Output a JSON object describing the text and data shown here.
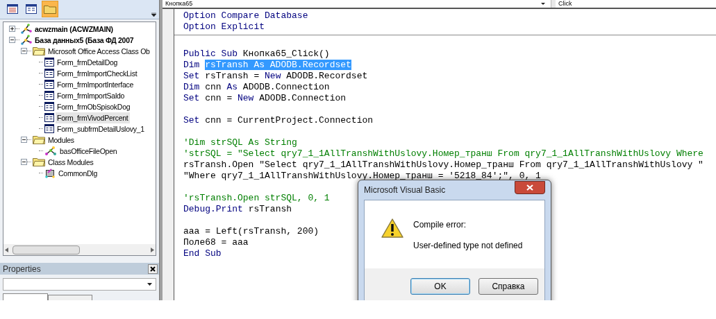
{
  "explorer": {
    "toolbar": [
      {
        "kind": "view_code",
        "selected": false
      },
      {
        "kind": "view_object",
        "selected": false
      },
      {
        "kind": "folders",
        "selected": true
      }
    ],
    "tree": [
      {
        "kind": "project",
        "label": "acwzmain (ACWZMAIN)",
        "bold": true,
        "expanded": false,
        "selected": false
      },
      {
        "kind": "project",
        "label": "База данных5 (База ФД 2007",
        "bold": true,
        "expanded": true,
        "selected": false,
        "children": [
          {
            "kind": "folder",
            "label": "Microsoft Office Access Class Ob",
            "expanded": true,
            "selected": false,
            "children": [
              {
                "kind": "form",
                "label": "Form_frmDetailDog",
                "selected": false
              },
              {
                "kind": "form",
                "label": "Form_frmImportCheckList",
                "selected": false
              },
              {
                "kind": "form",
                "label": "Form_frmImportInterface",
                "selected": false
              },
              {
                "kind": "form",
                "label": "Form_frmImportSaldo",
                "selected": false
              },
              {
                "kind": "form",
                "label": "Form_frmObSpisokDog",
                "selected": false
              },
              {
                "kind": "form",
                "label": "Form_frmVivodPercent",
                "selected": true
              },
              {
                "kind": "form",
                "label": "Form_subfrmDetailUslovy_1",
                "selected": false
              }
            ]
          },
          {
            "kind": "folder",
            "label": "Modules",
            "expanded": true,
            "selected": false,
            "children": [
              {
                "kind": "module",
                "label": "basOfficeFileOpen",
                "selected": false
              }
            ]
          },
          {
            "kind": "folder",
            "label": "Class Modules",
            "expanded": true,
            "selected": false,
            "children": [
              {
                "kind": "class",
                "label": "CommonDlg",
                "selected": false
              }
            ]
          }
        ]
      }
    ]
  },
  "properties": {
    "title": "Properties"
  },
  "code_window": {
    "object_combo": "Кнопка65",
    "procedure_combo": "Click",
    "lines": [
      {
        "kind": "code",
        "segments": [
          {
            "kind": "keyword",
            "text": "Option Compare Database"
          }
        ]
      },
      {
        "kind": "code",
        "segments": [
          {
            "kind": "keyword",
            "text": "Option Explicit"
          }
        ]
      },
      {
        "kind": "separator"
      },
      {
        "kind": "blank"
      },
      {
        "kind": "code",
        "segments": [
          {
            "kind": "keyword",
            "text": "Public Sub"
          },
          {
            "kind": "plain",
            "text": " Кнопка65_Click()"
          }
        ]
      },
      {
        "kind": "code",
        "segments": [
          {
            "kind": "keyword",
            "text": "Dim"
          },
          {
            "kind": "selection",
            "text": "rsTransh As ADODB.Recordset"
          }
        ]
      },
      {
        "kind": "code",
        "segments": [
          {
            "kind": "keyword",
            "text": "Set"
          },
          {
            "kind": "plain",
            "text": " rsTransh = "
          },
          {
            "kind": "keyword",
            "text": "New"
          },
          {
            "kind": "plain",
            "text": " ADODB.Recordset"
          }
        ]
      },
      {
        "kind": "code",
        "segments": [
          {
            "kind": "keyword",
            "text": "Dim"
          },
          {
            "kind": "plain",
            "text": " cnn "
          },
          {
            "kind": "keyword",
            "text": "As"
          },
          {
            "kind": "plain",
            "text": " ADODB.Connection"
          }
        ]
      },
      {
        "kind": "code",
        "segments": [
          {
            "kind": "keyword",
            "text": "Set"
          },
          {
            "kind": "plain",
            "text": " cnn = "
          },
          {
            "kind": "keyword",
            "text": "New"
          },
          {
            "kind": "plain",
            "text": " ADODB.Connection"
          }
        ]
      },
      {
        "kind": "blank"
      },
      {
        "kind": "code",
        "segments": [
          {
            "kind": "keyword",
            "text": "Set"
          },
          {
            "kind": "plain",
            "text": " cnn = CurrentProject.Connection"
          }
        ]
      },
      {
        "kind": "blank"
      },
      {
        "kind": "code",
        "segments": [
          {
            "kind": "comment",
            "text": "'Dim strSQL As String"
          }
        ]
      },
      {
        "kind": "code",
        "segments": [
          {
            "kind": "comment",
            "text": "'strSQL = \"Select qry7_1_1AllTranshWithUslovy.Номер_транш From qry7_1_1AllTranshWithUslovy Where"
          }
        ]
      },
      {
        "kind": "code",
        "segments": [
          {
            "kind": "plain",
            "text": "rsTransh.Open \"Select qry7_1_1AllTranshWithUslovy.Номер_транш From qry7_1_1AllTranshWithUslovy \""
          }
        ]
      },
      {
        "kind": "code",
        "segments": [
          {
            "kind": "plain",
            "text": "\"Where qry7_1_1AllTranshWithUslovy.Номер_транш = '5218_84';\", 0, 1"
          }
        ]
      },
      {
        "kind": "blank"
      },
      {
        "kind": "code",
        "segments": [
          {
            "kind": "comment",
            "text": "'rsTransh.Open strSQL, 0, 1"
          }
        ]
      },
      {
        "kind": "code",
        "segments": [
          {
            "kind": "keyword",
            "text": "Debug.Print"
          },
          {
            "kind": "plain",
            "text": " rsTransh"
          }
        ]
      },
      {
        "kind": "blank"
      },
      {
        "kind": "code",
        "segments": [
          {
            "kind": "plain",
            "text": "aaa = Left(rsTransh, 200)"
          }
        ]
      },
      {
        "kind": "code",
        "segments": [
          {
            "kind": "plain",
            "text": "Поле68 = aaa"
          }
        ]
      },
      {
        "kind": "code",
        "segments": [
          {
            "kind": "keyword",
            "text": "End Sub"
          }
        ]
      }
    ]
  },
  "dialog": {
    "title": "Microsoft Visual Basic",
    "heading": "Compile error:",
    "message": "User-defined type not defined",
    "buttons": [
      {
        "label": "OK",
        "default": true
      },
      {
        "label": "Справка",
        "default": false
      }
    ]
  }
}
